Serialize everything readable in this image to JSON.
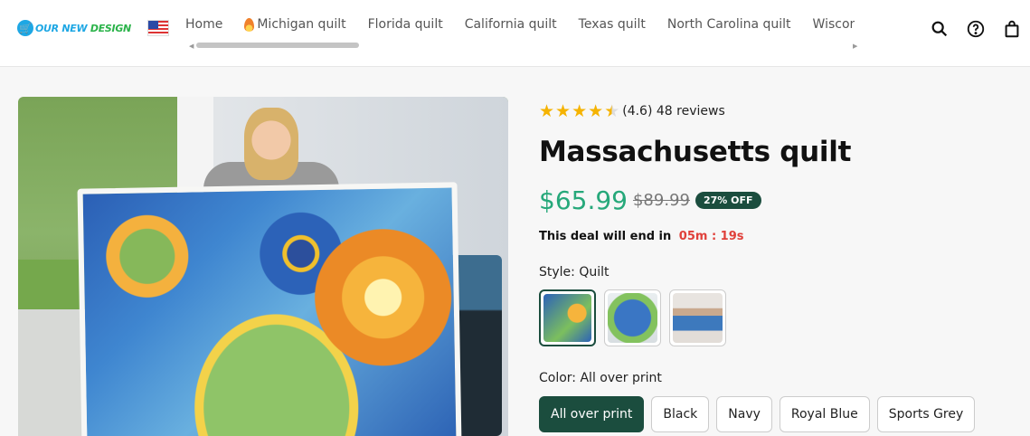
{
  "header": {
    "logo": "OUR NEW DESIGN",
    "logo_parts": [
      "OUR NEW",
      " DESIGN"
    ],
    "nav": [
      "Home",
      "Michigan quilt",
      "Florida quilt",
      "California quilt",
      "Texas quilt",
      "North Carolina quilt",
      "Wisconsin"
    ],
    "icons": [
      "search-icon",
      "help-icon",
      "shopping-bag-icon"
    ]
  },
  "product": {
    "rating": 4.6,
    "rating_text": "(4.6) 48 reviews",
    "title": "Massachusetts quilt",
    "price": "$65.99",
    "old_price": "$89.99",
    "discount": "27% OFF",
    "deal_text": "This deal will end in",
    "timer": "05m : 19s",
    "style_label": "Style: Quilt",
    "color_label": "Color: All over print",
    "colors": [
      "All over print",
      "Black",
      "Navy",
      "Royal Blue",
      "Sports Grey"
    ]
  },
  "theme": {
    "accent": "#1b4d3e",
    "price": "#26a87a",
    "timer": "#e0403a",
    "star": "#f5b301"
  }
}
